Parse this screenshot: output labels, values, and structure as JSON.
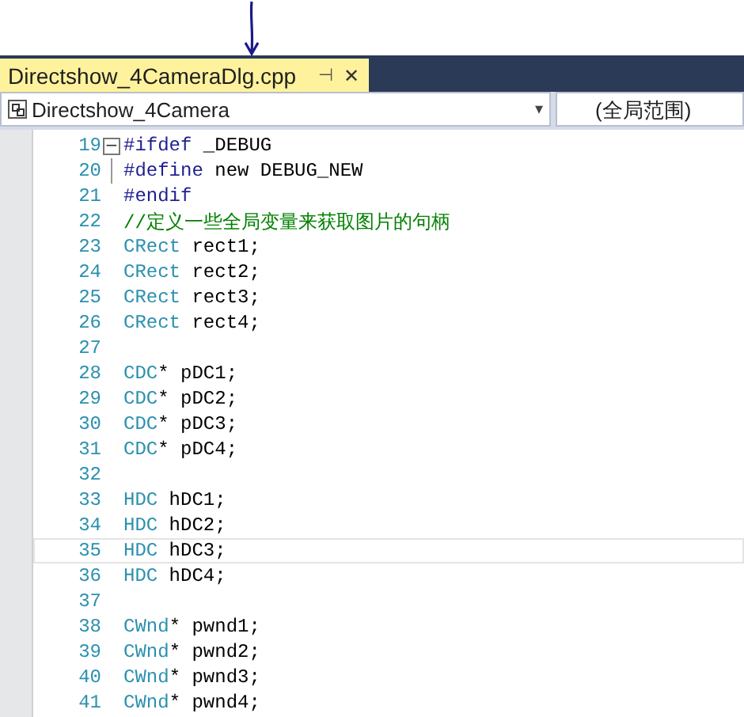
{
  "tab": {
    "label": "Directshow_4CameraDlg.cpp",
    "pin": "⊣",
    "close": "✕",
    "selected": true
  },
  "navigation": {
    "scope": "Directshow_4Camera",
    "caret": "▾",
    "member": "(全局范围)"
  },
  "lines": [
    {
      "number": "19",
      "kind": "fold-start",
      "fold_sign": "−",
      "selected": false,
      "tokens": [
        {
          "kind": "directive",
          "text": "#ifdef"
        },
        {
          "kind": "plain",
          "text": " _DEBUG"
        }
      ]
    },
    {
      "number": "20",
      "kind": "fold-body",
      "selected": false,
      "tokens": [
        {
          "kind": "directive",
          "text": "#define"
        },
        {
          "kind": "plain",
          "text": " new DEBUG_NEW"
        }
      ]
    },
    {
      "number": "21",
      "kind": "code",
      "selected": false,
      "tokens": [
        {
          "kind": "directive",
          "text": "#endif"
        }
      ]
    },
    {
      "number": "22",
      "kind": "code",
      "selected": false,
      "tokens": [
        {
          "kind": "comment",
          "text": "//定义一些全局变量来获取图片的句柄"
        }
      ]
    },
    {
      "number": "23",
      "kind": "code",
      "selected": false,
      "tokens": [
        {
          "kind": "type",
          "text": "CRect"
        },
        {
          "kind": "plain",
          "text": " rect1;"
        }
      ]
    },
    {
      "number": "24",
      "kind": "code",
      "selected": false,
      "tokens": [
        {
          "kind": "type",
          "text": "CRect"
        },
        {
          "kind": "plain",
          "text": " rect2;"
        }
      ]
    },
    {
      "number": "25",
      "kind": "code",
      "selected": false,
      "tokens": [
        {
          "kind": "type",
          "text": "CRect"
        },
        {
          "kind": "plain",
          "text": " rect3;"
        }
      ]
    },
    {
      "number": "26",
      "kind": "code",
      "selected": false,
      "tokens": [
        {
          "kind": "type",
          "text": "CRect"
        },
        {
          "kind": "plain",
          "text": " rect4;"
        }
      ]
    },
    {
      "number": "27",
      "kind": "code",
      "selected": false
    },
    {
      "number": "28",
      "kind": "code",
      "selected": false,
      "tokens": [
        {
          "kind": "type",
          "text": "CDC"
        },
        {
          "kind": "plain",
          "text": "* pDC1;"
        }
      ]
    },
    {
      "number": "29",
      "kind": "code",
      "selected": false,
      "tokens": [
        {
          "kind": "type",
          "text": "CDC"
        },
        {
          "kind": "plain",
          "text": "* pDC2;"
        }
      ]
    },
    {
      "number": "30",
      "kind": "code",
      "selected": false,
      "tokens": [
        {
          "kind": "type",
          "text": "CDC"
        },
        {
          "kind": "plain",
          "text": "* pDC3;"
        }
      ]
    },
    {
      "number": "31",
      "kind": "code",
      "selected": false,
      "tokens": [
        {
          "kind": "type",
          "text": "CDC"
        },
        {
          "kind": "plain",
          "text": "* pDC4;"
        }
      ]
    },
    {
      "number": "32",
      "kind": "code",
      "selected": false
    },
    {
      "number": "33",
      "kind": "code",
      "selected": false,
      "tokens": [
        {
          "kind": "type",
          "text": "HDC"
        },
        {
          "kind": "plain",
          "text": " hDC1;"
        }
      ]
    },
    {
      "number": "34",
      "kind": "code",
      "selected": false,
      "tokens": [
        {
          "kind": "type",
          "text": "HDC"
        },
        {
          "kind": "plain",
          "text": " hDC2;"
        }
      ]
    },
    {
      "number": "35",
      "kind": "code",
      "selected": true,
      "tokens": [
        {
          "kind": "type",
          "text": "HDC"
        },
        {
          "kind": "plain",
          "text": " hDC3;"
        }
      ]
    },
    {
      "number": "36",
      "kind": "code",
      "selected": false,
      "tokens": [
        {
          "kind": "type",
          "text": "HDC"
        },
        {
          "kind": "plain",
          "text": " hDC4;"
        }
      ]
    },
    {
      "number": "37",
      "kind": "code",
      "selected": false
    },
    {
      "number": "38",
      "kind": "code",
      "selected": false,
      "tokens": [
        {
          "kind": "type",
          "text": "CWnd"
        },
        {
          "kind": "plain",
          "text": "* pwnd1;"
        }
      ]
    },
    {
      "number": "39",
      "kind": "code",
      "selected": false,
      "tokens": [
        {
          "kind": "type",
          "text": "CWnd"
        },
        {
          "kind": "plain",
          "text": "* pwnd2;"
        }
      ]
    },
    {
      "number": "40",
      "kind": "code",
      "selected": false,
      "tokens": [
        {
          "kind": "type",
          "text": "CWnd"
        },
        {
          "kind": "plain",
          "text": "* pwnd3;"
        }
      ]
    },
    {
      "number": "41",
      "kind": "code",
      "selected": false,
      "tokens": [
        {
          "kind": "type",
          "text": "CWnd"
        },
        {
          "kind": "plain",
          "text": "* pwnd4;"
        }
      ]
    }
  ]
}
